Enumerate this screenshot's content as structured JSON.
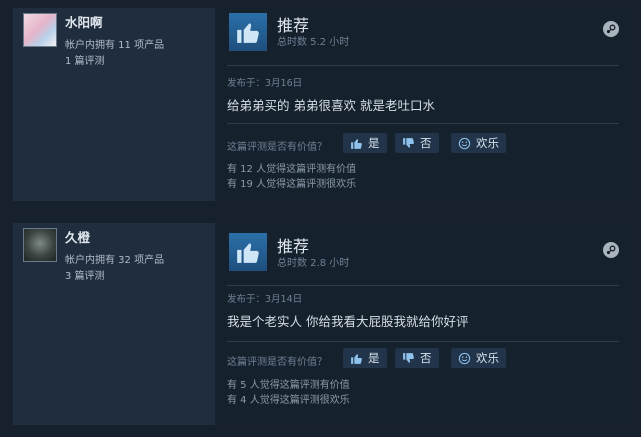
{
  "reviews": [
    {
      "username": "水阳啊",
      "products_owned": "帐户内拥有 11 项产品",
      "review_count": "1 篇评测",
      "recommendation": "推荐",
      "hours": "总时数 5.2 小时",
      "posted": "发布于：3月16日",
      "text": "给弟弟买的 弟弟很喜欢 就是老吐口水",
      "helpful_question": "这篇评测是否有价值？",
      "yes_label": "是",
      "no_label": "否",
      "funny_label": "欢乐",
      "helpful_count": "有 12 人觉得这篇评测有价值",
      "funny_count": "有 19 人觉得这篇评测很欢乐"
    },
    {
      "username": "久橙",
      "products_owned": "帐户内拥有 32 项产品",
      "review_count": "3 篇评测",
      "recommendation": "推荐",
      "hours": "总时数 2.8 小时",
      "posted": "发布于：3月14日",
      "text": "我是个老实人 你给我看大屁股我就给你好评",
      "helpful_question": "这篇评测是否有价值？",
      "yes_label": "是",
      "no_label": "否",
      "funny_label": "欢乐",
      "helpful_count": "有 5 人觉得这篇评测有价值",
      "funny_count": "有 4 人觉得这篇评测很欢乐"
    }
  ],
  "icons": {
    "thumbs_up_large": "thumbs-up-icon",
    "steam": "steam-icon",
    "vote_yes": "thumbs-up-small-icon",
    "vote_no": "thumbs-down-icon",
    "vote_funny": "smiley-icon"
  },
  "colors": {
    "background": "#17202d",
    "author_panel": "#1f2d3e",
    "button": "#21344a",
    "thumb_box": "#2b6fa8"
  }
}
